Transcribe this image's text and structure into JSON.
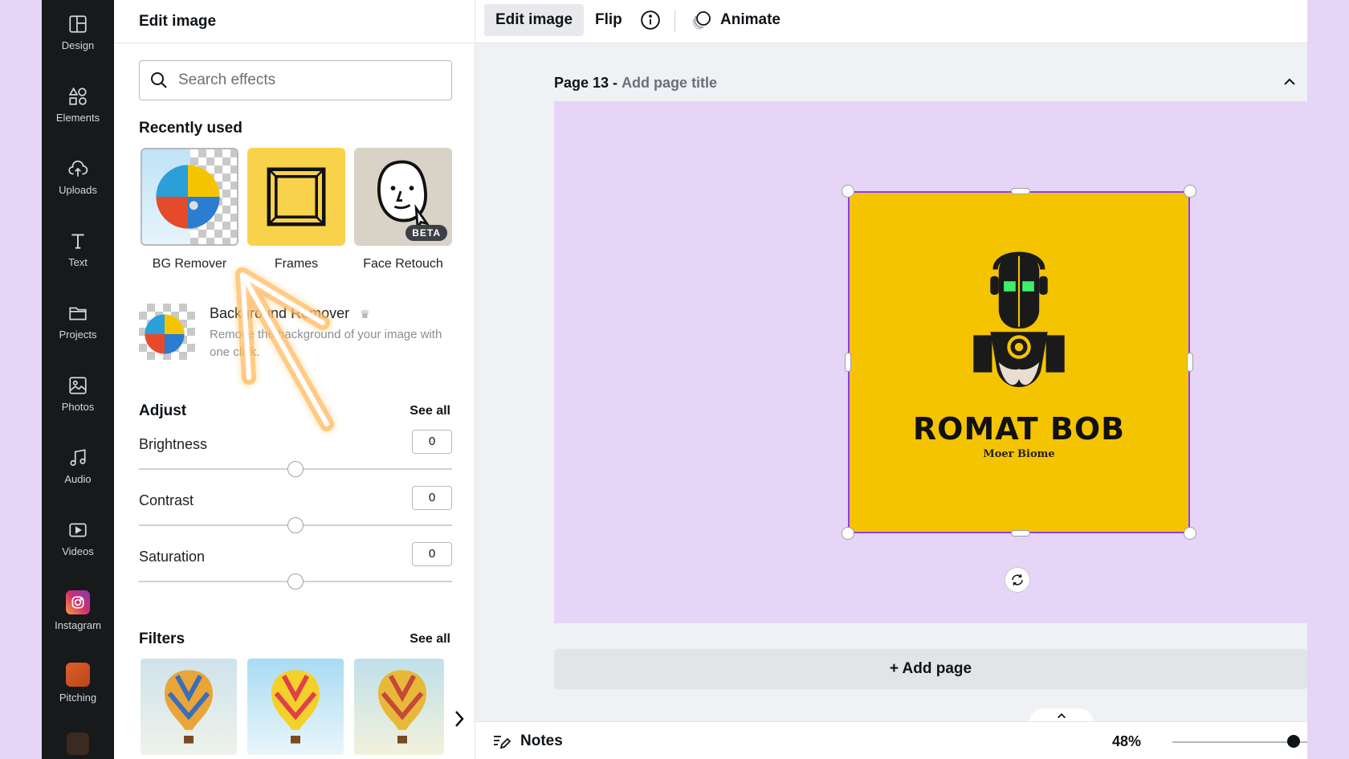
{
  "rail": {
    "items": [
      {
        "label": "Design",
        "icon": "layout-icon"
      },
      {
        "label": "Elements",
        "icon": "shapes-icon"
      },
      {
        "label": "Uploads",
        "icon": "cloud-upload-icon"
      },
      {
        "label": "Text",
        "icon": "text-icon"
      },
      {
        "label": "Projects",
        "icon": "folder-icon"
      },
      {
        "label": "Photos",
        "icon": "image-icon"
      },
      {
        "label": "Audio",
        "icon": "music-note-icon"
      },
      {
        "label": "Videos",
        "icon": "video-icon"
      },
      {
        "label": "Instagram",
        "icon": "instagram-icon"
      },
      {
        "label": "Pitching",
        "icon": "pitching-thumbnail"
      }
    ]
  },
  "panel": {
    "title": "Edit image",
    "search_placeholder": "Search effects",
    "recently_used_title": "Recently used",
    "effects": [
      {
        "name": "BG Remover"
      },
      {
        "name": "Frames"
      },
      {
        "name": "Face Retouch",
        "badge": "BETA"
      }
    ],
    "feature": {
      "title": "Background Remover",
      "description": "Remove the background of your image with one click."
    },
    "adjust_title": "Adjust",
    "adjust_see_all": "See all",
    "adjust": [
      {
        "label": "Brightness",
        "value": "0",
        "level": 0.5
      },
      {
        "label": "Contrast",
        "value": "0",
        "level": 0.5
      },
      {
        "label": "Saturation",
        "value": "0",
        "level": 0.5
      }
    ],
    "filters_title": "Filters",
    "filters_see_all": "See all"
  },
  "toolbar": {
    "edit_image": "Edit image",
    "flip": "Flip",
    "animate": "Animate"
  },
  "canvas": {
    "page_number": "Page 13 -",
    "page_title_placeholder": "Add page title",
    "logo_title": "ROMAT BOB",
    "logo_subtitle": "Moer Biome",
    "add_page": "+ Add page"
  },
  "bottom": {
    "notes": "Notes",
    "zoom": "48%",
    "zoom_level": 0.9
  },
  "colors": {
    "accent": "#8b3dff",
    "logo_bg": "#f5c400",
    "page_bg": "#e6d5f7",
    "rail_bg": "#18191b"
  }
}
